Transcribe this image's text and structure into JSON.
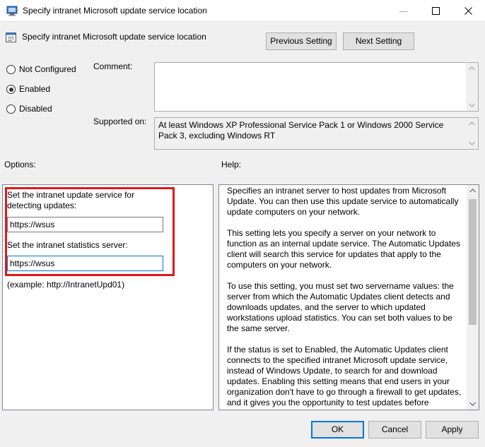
{
  "window": {
    "title": "Specify intranet Microsoft update service location",
    "minimize_icon": "minimize-icon",
    "maximize_icon": "maximize-icon",
    "close_icon": "close-icon"
  },
  "header": {
    "title": "Specify intranet Microsoft update service location",
    "previous_label": "Previous Setting",
    "next_label": "Next Setting"
  },
  "state": {
    "options": [
      {
        "label": "Not Configured",
        "selected": false
      },
      {
        "label": "Enabled",
        "selected": true
      },
      {
        "label": "Disabled",
        "selected": false
      }
    ]
  },
  "comment": {
    "label": "Comment:",
    "value": ""
  },
  "supported": {
    "label": "Supported on:",
    "value": "At least Windows XP Professional Service Pack 1 or Windows 2000 Service Pack 3, excluding Windows RT"
  },
  "options_section": {
    "label": "Options:",
    "detect_label": "Set the intranet update service for detecting updates:",
    "detect_value": "https://wsus",
    "stats_label": "Set the intranet statistics server:",
    "stats_value": "https://wsus",
    "example": "(example: http://IntranetUpd01)",
    "highlight_color": "#e0181a"
  },
  "help": {
    "label": "Help:",
    "paragraphs": [
      "Specifies an intranet server to host updates from Microsoft Update. You can then use this update service to automatically update computers on your network.",
      "This setting lets you specify a server on your network to function as an internal update service. The Automatic Updates client will search this service for updates that apply to the computers on your network.",
      "To use this setting, you must set two servername values: the server from which the Automatic Updates client detects and downloads updates, and the server to which updated workstations upload statistics. You can set both values to be the same server.",
      "If the status is set to Enabled, the Automatic Updates client connects to the specified intranet Microsoft update service, instead of Windows Update, to search for and download updates. Enabling this setting means that end users in your organization don't have to go through a firewall to get updates, and it gives you the opportunity to test updates before deploying"
    ]
  },
  "footer": {
    "ok": "OK",
    "cancel": "Cancel",
    "apply": "Apply"
  },
  "colors": {
    "accent": "#0078d7",
    "highlight": "#e0181a",
    "background": "#f0f0f0"
  }
}
